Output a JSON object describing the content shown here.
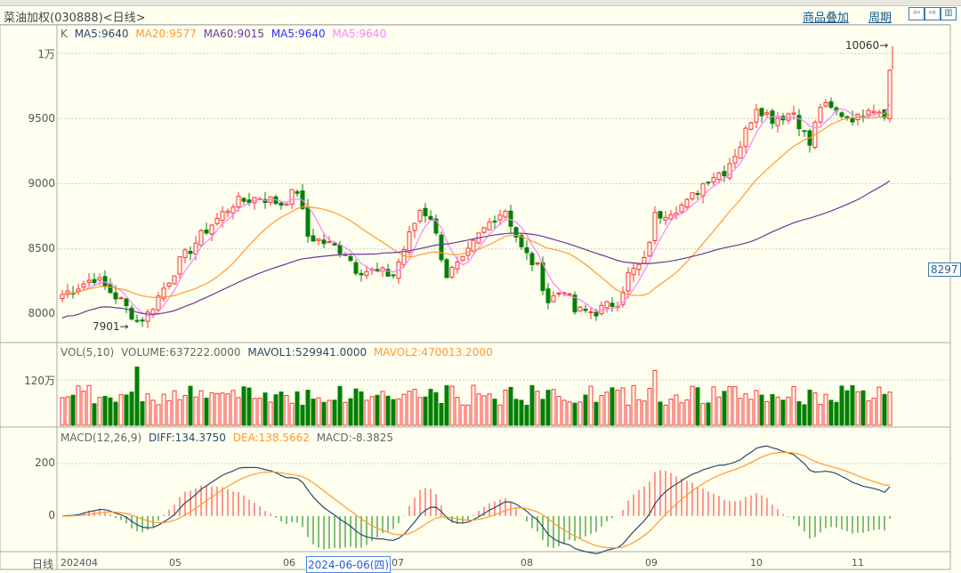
{
  "header": {
    "title": "菜油加权(030888)<日线>",
    "overlay_link": "商品叠加",
    "period_link": "周期",
    "nav_left": "⇦",
    "nav_right": "⇨",
    "layout_btn": "▥"
  },
  "price_legend": {
    "k": "K",
    "ma5": "MA5:9640",
    "ma20": "MA20:9577",
    "ma60": "MA60:9015",
    "ma5b": "MA5:9640",
    "ma5c": "MA5:9640"
  },
  "price_axis": [
    "1万",
    "9500",
    "9000",
    "8500",
    "8000"
  ],
  "annotations": {
    "high": "10060",
    "low": "7901",
    "current": "8297"
  },
  "vol_legend": {
    "name": "VOL(5,10)",
    "volume": "VOLUME:637222.0000",
    "mavol1": "MAVOL1:529941.0000",
    "mavol2": "MAVOL2:470013.2000"
  },
  "vol_axis": [
    "120万"
  ],
  "macd_legend": {
    "name": "MACD(12,26,9)",
    "diff": "DIFF:134.3750",
    "dea": "DEA:138.5662",
    "macd": "MACD:-8.3825"
  },
  "macd_axis": [
    "200",
    "0"
  ],
  "x_axis": {
    "label": "日线",
    "ticks": [
      "202404",
      "05",
      "06",
      "07",
      "08",
      "09",
      "10",
      "11"
    ],
    "selected": "2024-06-06(四)"
  },
  "colors": {
    "up": "#ff3030",
    "down": "#008000",
    "ma5": "#2a4a6a",
    "ma20": "#ff9a30",
    "ma60": "#6a3a9a",
    "ma5b": "#3030ff",
    "ma5c": "#ff80ff"
  },
  "chart_data": {
    "type": "candlestick",
    "bars": 156,
    "close_keypoints": [
      [
        0,
        8150
      ],
      [
        6,
        8280
      ],
      [
        11,
        8100
      ],
      [
        14,
        7950
      ],
      [
        16,
        8000
      ],
      [
        19,
        8200
      ],
      [
        22,
        8400
      ],
      [
        27,
        8650
      ],
      [
        32,
        8850
      ],
      [
        37,
        8900
      ],
      [
        41,
        8850
      ],
      [
        44,
        8950
      ],
      [
        46,
        8600
      ],
      [
        49,
        8550
      ],
      [
        53,
        8480
      ],
      [
        55,
        8350
      ],
      [
        59,
        8320
      ],
      [
        62,
        8300
      ],
      [
        64,
        8500
      ],
      [
        67,
        8800
      ],
      [
        69,
        8750
      ],
      [
        72,
        8300
      ],
      [
        75,
        8400
      ],
      [
        78,
        8600
      ],
      [
        81,
        8750
      ],
      [
        83,
        8800
      ],
      [
        86,
        8500
      ],
      [
        89,
        8350
      ],
      [
        91,
        8100
      ],
      [
        94,
        8200
      ],
      [
        96,
        8020
      ],
      [
        100,
        8020
      ],
      [
        104,
        8100
      ],
      [
        106,
        8300
      ],
      [
        109,
        8400
      ],
      [
        111,
        8750
      ],
      [
        114,
        8800
      ],
      [
        117,
        8850
      ],
      [
        121,
        9050
      ],
      [
        124,
        9100
      ],
      [
        127,
        9300
      ],
      [
        130,
        9600
      ],
      [
        133,
        9500
      ],
      [
        137,
        9550
      ],
      [
        140,
        9300
      ],
      [
        142,
        9600
      ],
      [
        145,
        9550
      ],
      [
        149,
        9500
      ],
      [
        151,
        9600
      ],
      [
        154,
        9550
      ],
      [
        155,
        9870
      ]
    ],
    "ylim": [
      7800,
      10100
    ]
  }
}
